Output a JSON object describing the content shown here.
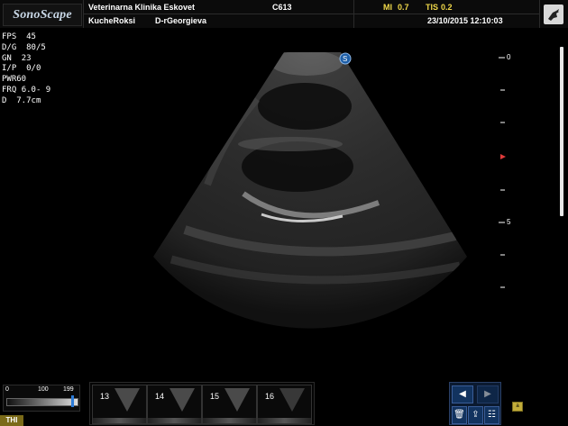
{
  "header": {
    "logo": "SonoScape",
    "clinic": "Veterinarna Klinika Eskovet",
    "probe": "C613",
    "mi_label": "MI",
    "mi_value": "0.7",
    "tis_label": "TIS",
    "tis_value": "0.2",
    "patient": "KucheRoksi",
    "operator": "D-rGeorgieva",
    "datetime": "23/10/2015 12:10:03"
  },
  "params": [
    {
      "label": "FPS",
      "value": "45"
    },
    {
      "label": "D/G",
      "value": "80/5"
    },
    {
      "label": "GN",
      "value": "23"
    },
    {
      "label": "I/P",
      "value": "0/0"
    },
    {
      "label": "PWR",
      "value": "60"
    },
    {
      "label": "FRQ",
      "value": "6.0- 9"
    },
    {
      "label": "D",
      "value": "7.7cm"
    }
  ],
  "depth_scale": {
    "label_top": "0",
    "label_mid": "5",
    "focus_color": "#e03a3a"
  },
  "gain_bar": {
    "min": "0",
    "mid": "100",
    "max": "199",
    "level": 0.95
  },
  "thi_label": "THI",
  "cine_frames": [
    {
      "num": "13"
    },
    {
      "num": "14"
    },
    {
      "num": "15"
    },
    {
      "num": "16"
    }
  ],
  "nav": {
    "prev": "◀",
    "next": "▶",
    "trash": "🗑",
    "export": "⇪",
    "list": "☷"
  },
  "lock_label": "a"
}
